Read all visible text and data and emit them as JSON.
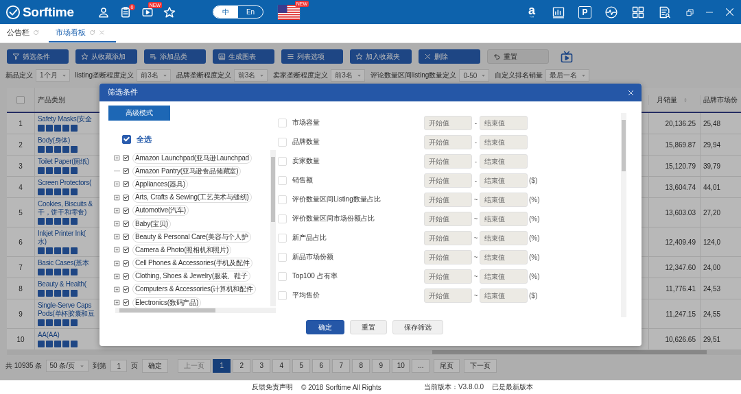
{
  "header": {
    "logo": "Sorftime",
    "nav_icons": [
      {
        "kind": "user"
      },
      {
        "kind": "clipboard",
        "badge": "0"
      },
      {
        "kind": "video",
        "badge": "NEW"
      },
      {
        "kind": "star"
      }
    ],
    "languages": [
      {
        "label": "中",
        "selected": true
      },
      {
        "label": "En",
        "selected": false
      }
    ],
    "flag_badge": "NEW",
    "tool_icons": [
      {
        "kind": "letter",
        "glyph": "a"
      },
      {
        "kind": "chart"
      },
      {
        "kind": "framed-letter",
        "glyph": "P"
      },
      {
        "kind": "pulse"
      },
      {
        "kind": "grid"
      },
      {
        "kind": "doc-search"
      }
    ],
    "window_controls": [
      {
        "kind": "restore"
      },
      {
        "kind": "minimize"
      },
      {
        "kind": "close"
      }
    ]
  },
  "tabs": [
    {
      "label": "公告栏",
      "selected": false,
      "closable": false
    },
    {
      "label": "市场看板",
      "selected": true,
      "closable": true
    }
  ],
  "toolbar": [
    {
      "label": "筛选条件",
      "kind": "primary"
    },
    {
      "label": "从收藏添加",
      "kind": "primary"
    },
    {
      "label": "添加品类",
      "kind": "primary"
    },
    {
      "label": "生成图表",
      "kind": "primary"
    },
    {
      "label": "列表选项",
      "kind": "primary"
    },
    {
      "label": "加入收藏夹",
      "kind": "primary"
    },
    {
      "label": "删除",
      "kind": "primary"
    },
    {
      "label": "重置",
      "kind": "secondary"
    }
  ],
  "filters": [
    {
      "label": "新品定义",
      "value": "1个月"
    },
    {
      "label": "listing垄断程度定义",
      "value": "前3名"
    },
    {
      "label": "品牌垄断程度定义",
      "value": "前3名"
    },
    {
      "label": "卖家垄断程度定义",
      "value": "前3名"
    },
    {
      "label": "评论数量区间listing数量定义",
      "value": "0-50"
    },
    {
      "label": "自定义排名销量",
      "value": "最后一名"
    }
  ],
  "table": {
    "header_checked": false,
    "columns": [
      "产品类别",
      "月销量",
      "品牌市场份"
    ],
    "rows": [
      {
        "no": "1",
        "name": [
          "Safety Masks(安全"
        ],
        "monthly_sales": "20,136.25",
        "column_3": "25,48"
      },
      {
        "no": "2",
        "name": [
          "Body(身体)"
        ],
        "monthly_sales": "15,869.87",
        "column_3": "29,94"
      },
      {
        "no": "3",
        "name": [
          "Toilet Paper(厕纸)"
        ],
        "monthly_sales": "15,120.79",
        "column_3": "39,79"
      },
      {
        "no": "4",
        "name": [
          "Screen Protectors("
        ],
        "monthly_sales": "13,604.74",
        "column_3": "44,01"
      },
      {
        "no": "5",
        "name": [
          "Cookies, Biscuits &",
          "干，饼干和零食)"
        ],
        "monthly_sales": "13,603.03",
        "column_3": "27,20"
      },
      {
        "no": "6",
        "name": [
          "Inkjet Printer Ink(",
          "水)"
        ],
        "monthly_sales": "12,409.49",
        "column_3": "124,0"
      },
      {
        "no": "7",
        "name": [
          "Basic Cases(基本"
        ],
        "monthly_sales": "12,347.60",
        "column_3": "24,00"
      },
      {
        "no": "8",
        "name": [
          "Beauty & Health("
        ],
        "monthly_sales": "11,776.41",
        "column_3": "24,53"
      },
      {
        "no": "9",
        "name": [
          "Single-Serve Caps",
          "Pods(单杯胶囊和豆"
        ],
        "monthly_sales": "11,247.15",
        "column_3": "24,55"
      },
      {
        "no": "10",
        "name": [
          "AA(AA)"
        ],
        "monthly_sales": "10,626.65",
        "column_3": "29,51"
      }
    ]
  },
  "pager": {
    "total": "共 10935 条",
    "page_size": "50 条/页",
    "goto_label": "到第",
    "goto_value": "1",
    "page_label": "页",
    "confirm": "确定",
    "prev": "上一页",
    "pages": [
      {
        "label": "1",
        "selected": true
      },
      {
        "label": "2",
        "selected": false
      },
      {
        "label": "3",
        "selected": false
      },
      {
        "label": "4",
        "selected": false
      },
      {
        "label": "5",
        "selected": false
      },
      {
        "label": "6",
        "selected": false
      },
      {
        "label": "7",
        "selected": false
      },
      {
        "label": "8",
        "selected": false
      },
      {
        "label": "9",
        "selected": false
      },
      {
        "label": "10",
        "selected": false
      },
      {
        "label": "...",
        "selected": false
      }
    ],
    "last": "尾页",
    "next": "下一页"
  },
  "dialog": {
    "title": "筛选条件",
    "mode_button": "高级模式",
    "select_all": {
      "label": "全选",
      "checked": true
    },
    "categories": [
      {
        "label": "Amazon Launchpad(亚马逊Launchpad",
        "checked": true,
        "expandable": true
      },
      {
        "label": "Amazon Pantry(亚马逊食品储藏室)",
        "checked": true,
        "expandable": false
      },
      {
        "label": "Appliances(器具)",
        "checked": true,
        "expandable": true
      },
      {
        "label": "Arts, Crafts & Sewing(工艺美术与缝纫)",
        "checked": true,
        "expandable": true
      },
      {
        "label": "Automotive(汽车)",
        "checked": true,
        "expandable": true
      },
      {
        "label": "Baby(宝贝)",
        "checked": true,
        "expandable": true
      },
      {
        "label": "Beauty & Personal Care(美容与个人护",
        "checked": true,
        "expandable": true
      },
      {
        "label": "Camera & Photo(照相机和照片)",
        "checked": true,
        "expandable": true
      },
      {
        "label": "Cell Phones & Accessories(手机及配件",
        "checked": true,
        "expandable": true
      },
      {
        "label": "Clothing, Shoes & Jewelry(服装、鞋子",
        "checked": true,
        "expandable": true
      },
      {
        "label": "Computers & Accessories(计算机和配件",
        "checked": true,
        "expandable": true
      },
      {
        "label": "Electronics(数码产品)",
        "checked": true,
        "expandable": true
      }
    ],
    "criteria": [
      {
        "label": "市场容量",
        "checked": false,
        "fields": [
          {
            "placeholder": "开始值"
          },
          {
            "placeholder": "结束值"
          }
        ],
        "separator": "-"
      },
      {
        "label": "品牌数量",
        "checked": false,
        "fields": [
          {
            "placeholder": "开始值"
          },
          {
            "placeholder": "结束值"
          }
        ],
        "separator": "-"
      },
      {
        "label": "卖家数量",
        "checked": false,
        "fields": [
          {
            "placeholder": "开始值"
          },
          {
            "placeholder": "结束值"
          }
        ],
        "separator": "-"
      },
      {
        "label": "销售额",
        "checked": false,
        "fields": [
          {
            "placeholder": "开始值"
          },
          {
            "placeholder": "结束值"
          }
        ],
        "separator": "-",
        "unit": "($)"
      },
      {
        "label": "评价数量区间Listing数量占比",
        "checked": false,
        "fields": [
          {
            "placeholder": "开始值"
          },
          {
            "placeholder": "结束值"
          }
        ],
        "separator": "~",
        "unit": "(%)"
      },
      {
        "label": "评价数量区间市场份额占比",
        "checked": false,
        "fields": [
          {
            "placeholder": "开始值"
          },
          {
            "placeholder": "结束值"
          }
        ],
        "separator": "~",
        "unit": "(%)"
      },
      {
        "label": "新产品占比",
        "checked": false,
        "fields": [
          {
            "placeholder": "开始值"
          },
          {
            "placeholder": "结束值"
          }
        ],
        "separator": "~",
        "unit": "(%)"
      },
      {
        "label": "新品市场份额",
        "checked": false,
        "fields": [
          {
            "placeholder": "开始值"
          },
          {
            "placeholder": "结束值"
          }
        ],
        "separator": "~",
        "unit": "(%)"
      },
      {
        "label": "Top100 占有率",
        "checked": false,
        "fields": [
          {
            "placeholder": "开始值"
          },
          {
            "placeholder": "结束值"
          }
        ],
        "separator": "~",
        "unit": "(%)"
      },
      {
        "label": "平均售价",
        "checked": false,
        "fields": [
          {
            "placeholder": "开始值"
          },
          {
            "placeholder": "结束值"
          }
        ],
        "separator": "~",
        "unit": "($)"
      }
    ],
    "buttons": [
      {
        "label": "确定",
        "kind": "primary"
      },
      {
        "label": "重置",
        "kind": "default"
      },
      {
        "label": "保存筛选",
        "kind": "default"
      }
    ]
  },
  "footer": {
    "link": "反馈免责声明",
    "copyright": "© 2018 Sorftime All Rights",
    "version": "当前版本：V3.8.0.0",
    "update_status": "已是最新版本"
  }
}
